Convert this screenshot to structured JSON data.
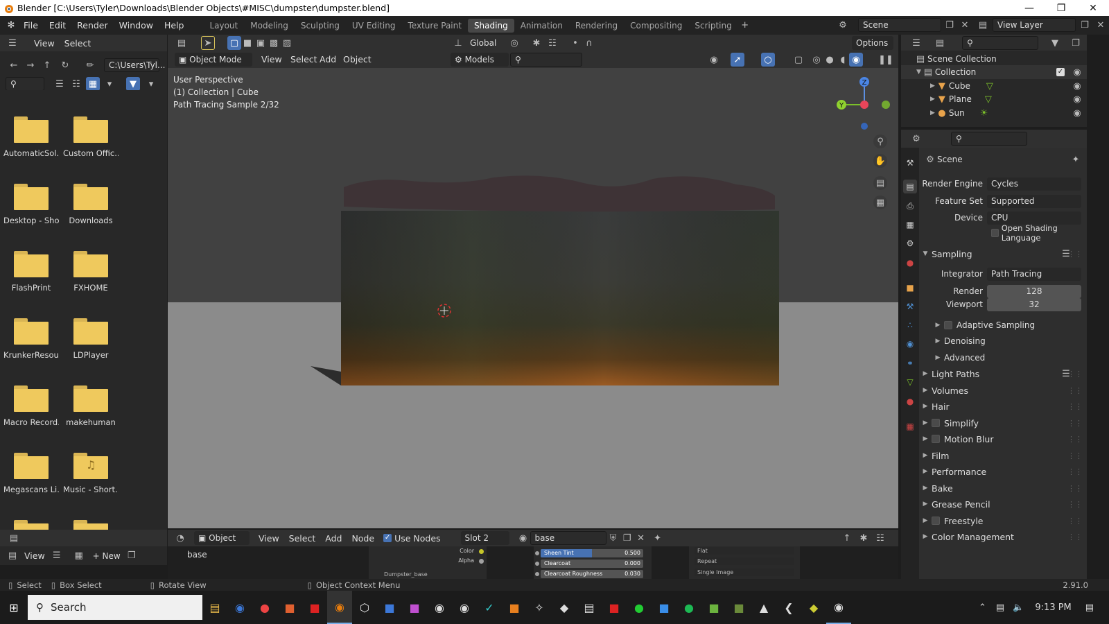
{
  "window": {
    "title": "Blender [C:\\Users\\Tyler\\Downloads\\Blender Objects\\#MISC\\dumpster\\dumpster.blend]"
  },
  "menus": [
    "File",
    "Edit",
    "Render",
    "Window",
    "Help"
  ],
  "workspaces": [
    "Layout",
    "Modeling",
    "Sculpting",
    "UV Editing",
    "Texture Paint",
    "Shading",
    "Animation",
    "Rendering",
    "Compositing",
    "Scripting"
  ],
  "active_workspace": "Shading",
  "scene_field": "Scene",
  "viewlayer_field": "View Layer",
  "filebrowser": {
    "view_label": "View",
    "select_label": "Select",
    "path": "C:\\Users\\Tyl...",
    "folders": [
      "AutomaticSol...",
      "Custom Offic...",
      "Desktop - Sho...",
      "Downloads",
      "FlashPrint",
      "FXHOME",
      "KrunkerResou...",
      "LDPlayer",
      "Macro Record...",
      "makehuman",
      "Megascans Li...",
      "Music - Short..."
    ]
  },
  "viewport": {
    "transform": "Global",
    "options_label": "Options",
    "mode": "Object Mode",
    "menu": [
      "View",
      "Select",
      "Add",
      "Object"
    ],
    "models_label": "Models",
    "overlay_lines": [
      "User Perspective",
      "(1) Collection | Cube",
      "Path Tracing Sample 2/32"
    ],
    "gizmo_labels": {
      "z": "Z",
      "y": "Y"
    }
  },
  "outliner": {
    "root": "Scene Collection",
    "collection": "Collection",
    "items": [
      "Cube",
      "Plane",
      "Sun"
    ]
  },
  "properties": {
    "header": "Scene",
    "render_engine_label": "Render Engine",
    "render_engine": "Cycles",
    "feature_set_label": "Feature Set",
    "feature_set": "Supported",
    "device_label": "Device",
    "device": "CPU",
    "osl_label": "Open Shading Language",
    "sampling_label": "Sampling",
    "integrator_label": "Integrator",
    "integrator": "Path Tracing",
    "render_label": "Render",
    "render_samples": "128",
    "viewport_label": "Viewport",
    "viewport_samples": "32",
    "subsections": [
      "Adaptive Sampling",
      "Denoising",
      "Advanced"
    ],
    "sections": [
      "Light Paths",
      "Volumes",
      "Hair",
      "Simplify",
      "Motion Blur",
      "Film",
      "Performance",
      "Bake",
      "Grease Pencil",
      "Freestyle",
      "Color Management"
    ]
  },
  "node_editor": {
    "object_label": "Object",
    "menu": [
      "View",
      "Select",
      "Add",
      "Node"
    ],
    "use_nodes": "Use Nodes",
    "slot": "Slot 2",
    "material": "base",
    "breadcrumb": "base",
    "sockets": [
      "Color",
      "Alpha"
    ],
    "params": [
      {
        "name": "Sheen Tint",
        "value": "0.500",
        "fill": 0.5
      },
      {
        "name": "Clearcoat",
        "value": "0.000",
        "fill": 0
      },
      {
        "name": "Clearcoat Roughness",
        "value": "0.030",
        "fill": 0
      }
    ],
    "img_opts": [
      "Flat",
      "Repeat",
      "Single Image"
    ],
    "node_title": "Dumpster_base"
  },
  "bottom_left": {
    "view_label": "View",
    "new_label": "New"
  },
  "statusbar": {
    "select": "Select",
    "box_select": "Box Select",
    "rotate": "Rotate View",
    "context": "Object Context Menu",
    "version": "2.91.0"
  },
  "taskbar": {
    "search": "Search",
    "time": "9:13 PM"
  }
}
